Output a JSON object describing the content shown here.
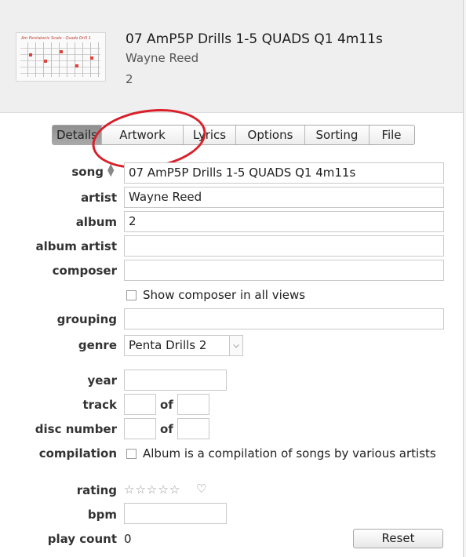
{
  "header": {
    "title": "07 AmP5P Drills 1-5 QUADS Q1 4m11s",
    "artist": "Wayne Reed",
    "album": "2",
    "artwork_caption": "Am Pentatonic Scale - Quads Drill 1"
  },
  "tabs": [
    {
      "label": "Details",
      "active": true
    },
    {
      "label": "Artwork",
      "active": false
    },
    {
      "label": "Lyrics",
      "active": false
    },
    {
      "label": "Options",
      "active": false
    },
    {
      "label": "Sorting",
      "active": false
    },
    {
      "label": "File",
      "active": false
    }
  ],
  "form": {
    "song": {
      "label": "song",
      "value": "07 AmP5P Drills 1-5 QUADS Q1 4m11s"
    },
    "artist": {
      "label": "artist",
      "value": "Wayne Reed"
    },
    "album": {
      "label": "album",
      "value": "2"
    },
    "album_artist": {
      "label": "album artist",
      "value": ""
    },
    "composer": {
      "label": "composer",
      "value": ""
    },
    "show_composer": {
      "label": "Show composer in all views",
      "checked": false
    },
    "grouping": {
      "label": "grouping",
      "value": ""
    },
    "genre": {
      "label": "genre",
      "value": "Penta Drills 2"
    },
    "year": {
      "label": "year",
      "value": ""
    },
    "track": {
      "label": "track",
      "of": "of",
      "value": "",
      "total": ""
    },
    "disc_number": {
      "label": "disc number",
      "of": "of",
      "value": "",
      "total": ""
    },
    "compilation": {
      "label": "compilation",
      "checkbox_label": "Album is a compilation of songs by various artists",
      "checked": false
    },
    "rating": {
      "label": "rating",
      "stars": 0,
      "max_stars": 5,
      "loved": false
    },
    "bpm": {
      "label": "bpm",
      "value": ""
    },
    "play_count": {
      "label": "play count",
      "value": "0",
      "reset_label": "Reset"
    }
  },
  "icons": {
    "sort": "sort-updown-icon",
    "star": "star-outline-icon",
    "heart": "heart-outline-icon",
    "dropdown": "chevron-down-icon"
  },
  "colors": {
    "annotation": "#d9202a",
    "header_bg": "#efefef",
    "active_tab": "#9b9b9b"
  }
}
